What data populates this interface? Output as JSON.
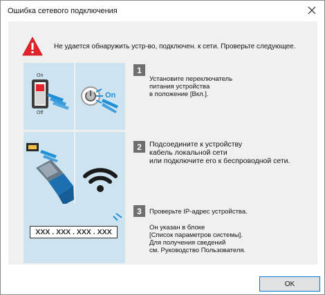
{
  "window": {
    "title": "Ошибка сетевого подключения",
    "close_icon": "close-icon"
  },
  "message": {
    "icon": "warning-icon",
    "text": "Не удается обнаружить устр-во, подключен. к сети. Проверьте следующее."
  },
  "steps": [
    {
      "number": "1",
      "lines": [
        "Установите переключатель",
        "питания устройства",
        "в положение [Вкл.]."
      ],
      "image_icons": [
        "power-switch-icon",
        "power-button-icon"
      ],
      "on_label": "On",
      "on_label_switch": "On",
      "off_label_switch": "Off"
    },
    {
      "number": "2",
      "lines": [
        "Подсоедините к устройству",
        "кабель локальной сети",
        "или подключите его к беспроводной сети."
      ],
      "image_icons": [
        "lan-cable-icon",
        "wifi-icon"
      ]
    },
    {
      "number": "3",
      "lines": [
        "Проверьте IP-адрес устройства."
      ],
      "detail_lines": [
        "Он указан в блоке",
        "[Список параметров системы].",
        "Для получения сведений",
        "см. Руководство Пользователя."
      ],
      "ip_placeholder": "XXX . XXX . XXX . XXX",
      "image_icons": [
        "ip-address-icon"
      ]
    }
  ],
  "buttons": {
    "ok_label": "OK"
  },
  "colors": {
    "tile_bg": "#cde3f0",
    "accent_blue": "#1f8fd6",
    "warning_red": "#e2232a",
    "step_badge": "#6e6e6e",
    "button_focus_border": "#0078d7"
  }
}
